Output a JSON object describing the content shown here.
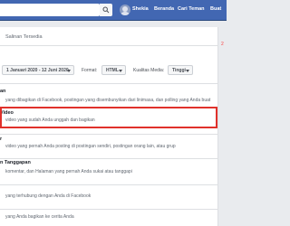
{
  "header": {
    "user_name": "Shekia",
    "nav": [
      "Beranda",
      "Cari Teman",
      "Buat"
    ]
  },
  "download": {
    "header_text": "Salinan Tersedia",
    "date_range": "1 Januari 2020 - 12 Juni 2020",
    "format_label": "Format:",
    "format_value": "HTML",
    "quality_label": "Kualitas Media:",
    "quality_value": "Tinggi",
    "side_marker": "2"
  },
  "sections": [
    {
      "title": "an",
      "desc": "yang dibagikan di Facebook, postingan yang disembunyikan dari linimasa, dan polling yang Anda buat"
    },
    {
      "title": "Video",
      "desc": "video yang sudah Anda unggah dan bagikan"
    },
    {
      "title": "r",
      "desc": "video yang pernah Anda posting di postingan sendiri, postingan orang lain, atau grup"
    },
    {
      "title": "n Tanggapan",
      "desc": "komentar, dan Halaman yang pernah Anda sukai atau tanggapi"
    },
    {
      "title": "",
      "desc": "yang terhubung dengan Anda di Facebook"
    },
    {
      "title": "",
      "desc": "yang Anda bagikan ke cerita Anda"
    }
  ],
  "colors": {
    "brand": "#4267b2",
    "highlight": "#e0312b"
  }
}
